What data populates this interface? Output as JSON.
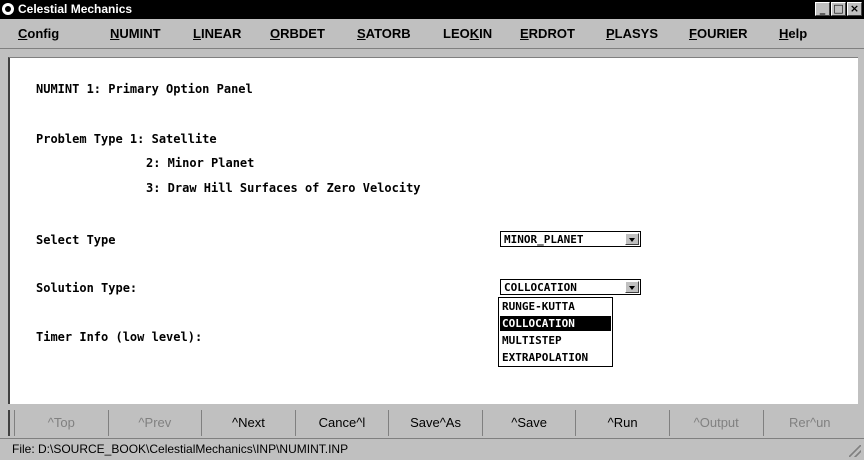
{
  "window": {
    "title": "Celestial Mechanics",
    "controls": [
      "_",
      "□",
      "×"
    ]
  },
  "menu": [
    {
      "label": "Config",
      "u": "C"
    },
    {
      "label": "NUMINT",
      "u": "N"
    },
    {
      "label": "LINEAR",
      "u": "L"
    },
    {
      "label": "ORBDET",
      "u": "O"
    },
    {
      "label": "SATORB",
      "u": "S"
    },
    {
      "label": "LEOKIN",
      "u": "K"
    },
    {
      "label": "ERDROT",
      "u": "E"
    },
    {
      "label": "PLASYS",
      "u": "P"
    },
    {
      "label": "FOURIER",
      "u": "F"
    },
    {
      "label": "Help",
      "u": "H"
    }
  ],
  "panel": {
    "heading": "NUMINT 1: Primary Option Panel",
    "problem_type_label": "Problem Type 1: Satellite",
    "problem_type_2": "2: Minor Planet",
    "problem_type_3": "3: Draw Hill Surfaces of Zero Velocity",
    "select_type_label": "Select Type",
    "select_type_value": "MINOR_PLANET",
    "solution_type_label": "Solution Type:",
    "solution_type_value": "COLLOCATION",
    "solution_options": [
      "RUNGE-KUTTA",
      "COLLOCATION",
      "MULTISTEP",
      "EXTRAPOLATION"
    ],
    "solution_selected_index": 1,
    "timer_label": "Timer Info (low level):"
  },
  "buttons": [
    {
      "label": "^Top",
      "enabled": false
    },
    {
      "label": "^Prev",
      "enabled": false
    },
    {
      "label": "^Next",
      "enabled": true
    },
    {
      "label": "Cance^l",
      "enabled": true
    },
    {
      "label": "Save^As",
      "enabled": true
    },
    {
      "label": "^Save",
      "enabled": true
    },
    {
      "label": "^Run",
      "enabled": true
    },
    {
      "label": "^Output",
      "enabled": false
    },
    {
      "label": "Rer^un",
      "enabled": false
    }
  ],
  "status": {
    "file": "File: D:\\SOURCE_BOOK\\CelestialMechanics\\INP\\NUMINT.INP"
  }
}
